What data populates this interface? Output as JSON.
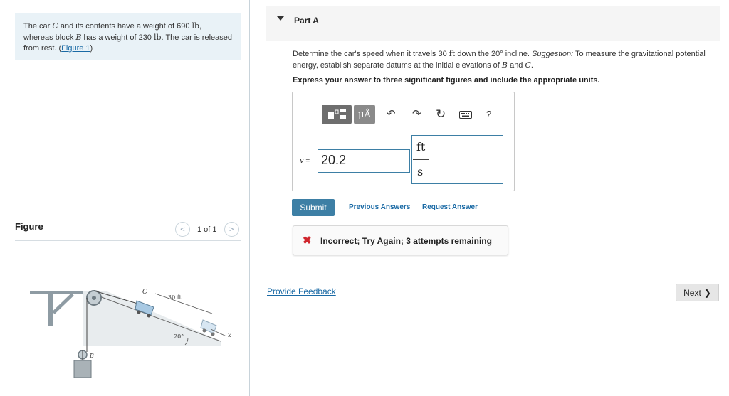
{
  "problem": {
    "text_before_c": "The car ",
    "car_symbol": "C",
    "text_after_c": " and its contents have a weight of 690 ",
    "unit_lb_1": "lb",
    "text_mid": ", whereas block ",
    "block_symbol": "B",
    "text_after_b": " has a weight of 230 ",
    "unit_lb_2": "lb",
    "text_end": ". The car is released from rest. (",
    "figure_link": "Figure 1",
    "text_close": ")"
  },
  "figure_panel": {
    "title": "Figure",
    "counter": "1 of 1",
    "prev_glyph": "<",
    "next_glyph": ">",
    "labels": {
      "car": "C",
      "distance": "30 ft",
      "angle": "20°",
      "block": "B",
      "axis": "x"
    }
  },
  "part": {
    "label": "Part A"
  },
  "question": {
    "text1": "Determine the car's speed when it travels 30 ",
    "unit_ft": "ft",
    "text2": " down the 20° incline. ",
    "suggestion_label": "Suggestion:",
    "text3": " To measure the gravitational potential energy, establish separate datums at the initial elevations of ",
    "sym_b": "B",
    "text4": " and ",
    "sym_c": "C",
    "text5": "."
  },
  "instruction": "Express your answer to three significant figures and include the appropriate units.",
  "toolbar": {
    "mu_label": "μÅ",
    "undo": "↶",
    "redo": "↷",
    "reset": "↻",
    "help": "?"
  },
  "answer": {
    "variable": "v",
    "equals": " =",
    "value": "20.2",
    "unit_numerator": "ft",
    "unit_denominator": "s"
  },
  "actions": {
    "submit": "Submit",
    "previous_answers": "Previous Answers",
    "request_answer": "Request Answer"
  },
  "feedback": {
    "icon": "✖",
    "message": "Incorrect; Try Again; 3 attempts remaining"
  },
  "footer": {
    "provide_feedback": "Provide Feedback",
    "next": "Next",
    "next_glyph": "❯"
  }
}
